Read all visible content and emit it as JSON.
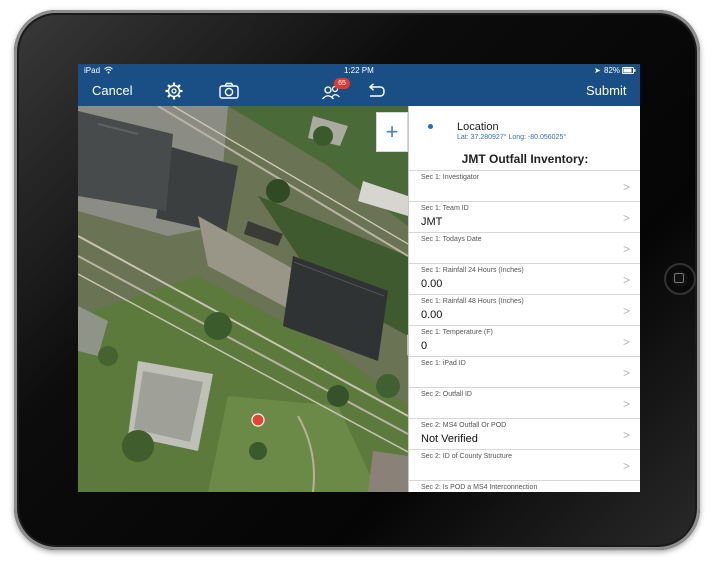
{
  "status_bar": {
    "carrier": "iPad",
    "time": "1:22 PM",
    "battery": "82%"
  },
  "nav": {
    "cancel_label": "Cancel",
    "submit_label": "Submit",
    "badge_count": "65",
    "icons": [
      "gear-icon",
      "camera-icon",
      "users-icon",
      "undo-icon"
    ]
  },
  "map": {
    "add_label": "+"
  },
  "location": {
    "title": "Location",
    "coords": "Lat: 37.280927° Long: -80.056025°"
  },
  "form": {
    "title": "JMT Outfall Inventory:",
    "fields": [
      {
        "label": "Sec 1: Investigator",
        "value": ""
      },
      {
        "label": "Sec 1: Team ID",
        "value": "JMT"
      },
      {
        "label": "Sec 1: Todays Date",
        "value": ""
      },
      {
        "label": "Sec 1: Rainfall 24 Hours (Inches)",
        "value": "0.00"
      },
      {
        "label": "Sec 1: Rainfall 48 Hours (Inches)",
        "value": "0.00"
      },
      {
        "label": "Sec 1: Temperature (F)",
        "value": "0"
      },
      {
        "label": "Sec 1: iPad ID",
        "value": ""
      },
      {
        "label": "Sec 2: Outfall ID",
        "value": ""
      },
      {
        "label": "Sec 2: MS4 Outfall Or POD",
        "value": "Not Verified"
      },
      {
        "label": "Sec 2: ID of County Structure",
        "value": ""
      },
      {
        "label": "Sec 2: Is POD a MS4 Interconnection",
        "value": ""
      }
    ]
  },
  "colors": {
    "nav_bar": "#1a4f86",
    "badge": "#e23b2e",
    "location_dot": "#1d6fd6",
    "map_marker": "#e8432f"
  }
}
